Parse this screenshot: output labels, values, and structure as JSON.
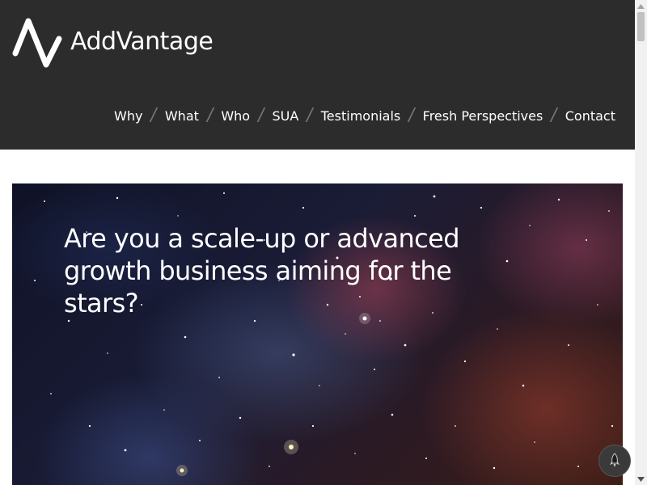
{
  "brand": {
    "name": "AddVantage",
    "logo_icon": "addvantage-logo-mark"
  },
  "nav": {
    "items": [
      {
        "label": "Why"
      },
      {
        "label": "What"
      },
      {
        "label": "Who"
      },
      {
        "label": "SUA"
      },
      {
        "label": "Testimonials"
      },
      {
        "label": "Fresh Perspectives"
      },
      {
        "label": "Contact"
      }
    ],
    "separator": "/"
  },
  "hero": {
    "heading": "Are you a scale-up or advanced growth business aiming for the stars?",
    "background": "galaxy-nebula-image"
  },
  "floating_button": {
    "icon": "rocket-icon"
  },
  "colors": {
    "header_bg": "#2d2c2c",
    "nav_text": "#ffffff",
    "separator": "#777777"
  }
}
